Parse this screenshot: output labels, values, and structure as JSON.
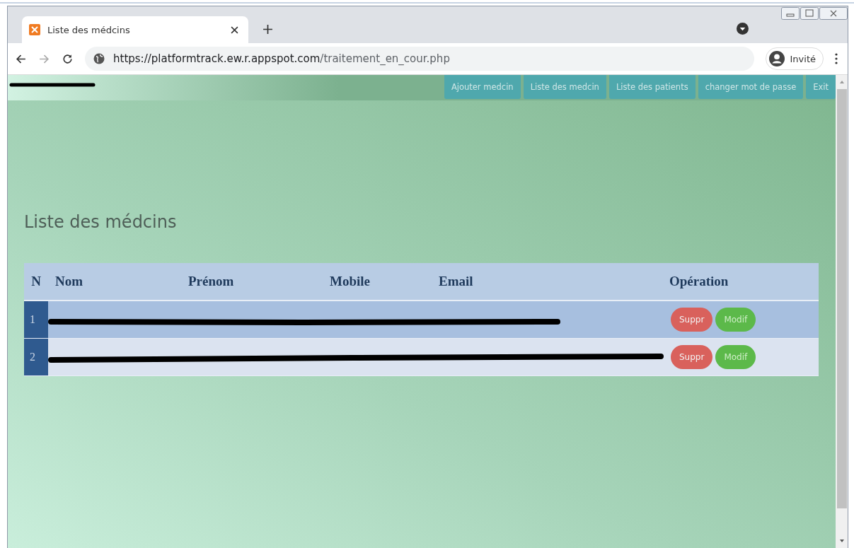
{
  "browser": {
    "tab_title": "Liste des médcins",
    "url_host": "https://platformtrack.ew.r.appspot.com",
    "url_path": "/traitement_en_cour.php",
    "profile": "Invité"
  },
  "nav": [
    {
      "label": "Ajouter medcin"
    },
    {
      "label": "Liste des medcin"
    },
    {
      "label": "Liste des patients"
    },
    {
      "label": "changer mot de passe"
    },
    {
      "label": "Exit"
    }
  ],
  "page_title": "Liste des médcins",
  "table": {
    "columns": [
      "N",
      "Nom",
      "Prénom",
      "Mobile",
      "Email",
      "Opération"
    ],
    "rows": [
      {
        "n": "1",
        "actions": [
          "Suppr",
          "Modif"
        ]
      },
      {
        "n": "2",
        "actions": [
          "Suppr",
          "Modif"
        ]
      }
    ]
  }
}
